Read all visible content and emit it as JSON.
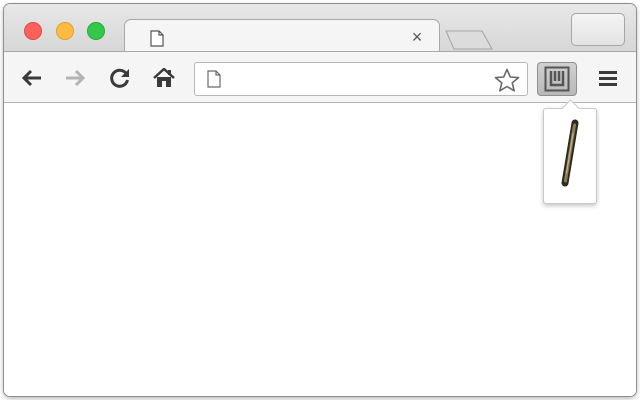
{
  "window": {
    "traffic_lights": {
      "close": "#fc605c",
      "minimize": "#fdbc40",
      "maximize": "#34c84a"
    }
  },
  "tab": {
    "title": "",
    "favicon": "page-icon",
    "close_glyph": "×"
  },
  "toolbar": {
    "back_icon": "arrow-left-icon",
    "forward_icon": "arrow-right-icon",
    "reload_icon": "reload-icon",
    "home_icon": "home-icon",
    "menu_icon": "hamburger-menu-icon"
  },
  "omnibox": {
    "value": "",
    "placeholder": "",
    "favicon": "page-icon",
    "star_icon": "star-outline-icon"
  },
  "extension": {
    "icon": "extension-logo-icon",
    "active": true,
    "popup_content_icon": "wooden-stick-icon"
  },
  "colors": {
    "toolbar_bg": "#f5f5f5",
    "tabstrip_bg": "#d9d9d9",
    "page_bg": "#ffffff"
  }
}
